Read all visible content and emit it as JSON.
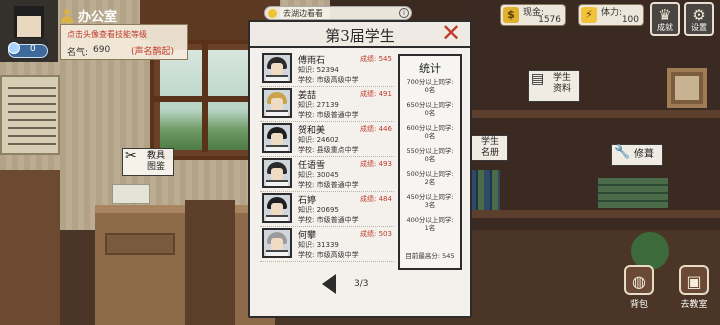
{
  "hud": {
    "level": "0",
    "location": "办公室",
    "hint": "点击头像查看技能等级",
    "fame_label": "名气:",
    "fame_value": "690",
    "fame_title": "(声名鹊起)"
  },
  "banner": {
    "text": "去湖边看看",
    "info_glyph": "i"
  },
  "resources": {
    "money_label": "现金:",
    "money_value": "1576",
    "money_icon": "$",
    "stamina_label": "体力:",
    "stamina_value": "100",
    "stamina_icon": "⚡"
  },
  "corner_buttons": {
    "achievement_label": "成就",
    "achievement_icon": "♛",
    "settings_label": "设置",
    "settings_icon": "⚙"
  },
  "scene_tags": {
    "teacher_plan": "教具图鉴",
    "student_info": "学生资料",
    "student_roster": "学生名册",
    "repair": "修葺"
  },
  "bottom_buttons": {
    "bag_label": "背包",
    "bag_icon": "◍",
    "class_label": "去教室",
    "class_icon": "▣"
  },
  "modal": {
    "title": "第3届学生",
    "close_glyph": "✕",
    "knowledge_prefix": "知识:",
    "school_prefix": "学校:",
    "score_prefix": "成绩:",
    "students": [
      {
        "name": "傅雨石",
        "score": "545",
        "knowledge": "52394",
        "school": "市级高级中学",
        "hair": "#2a2a2a"
      },
      {
        "name": "姜喆",
        "score": "491",
        "knowledge": "27139",
        "school": "市级普通中学",
        "hair": "#c9a24a"
      },
      {
        "name": "贺和美",
        "score": "446",
        "knowledge": "24602",
        "school": "县级重点中学",
        "hair": "#1f1f1f"
      },
      {
        "name": "任语雪",
        "score": "493",
        "knowledge": "30045",
        "school": "市级普通中学",
        "hair": "#2a2a2a"
      },
      {
        "name": "石婷",
        "score": "484",
        "knowledge": "20695",
        "school": "市级普通中学",
        "hair": "#1f1f1f"
      },
      {
        "name": "何攀",
        "score": "503",
        "knowledge": "31339",
        "school": "市级高级中学",
        "hair": "#9b9b9b"
      }
    ],
    "stats": {
      "title": "统计",
      "rows": [
        {
          "label": "700分以上同学:",
          "count": "0名"
        },
        {
          "label": "650分以上同学:",
          "count": "0名"
        },
        {
          "label": "600分以上同学:",
          "count": "0名"
        },
        {
          "label": "550分以上同学:",
          "count": "0名"
        },
        {
          "label": "500分以上同学:",
          "count": "2名"
        },
        {
          "label": "450分以上同学:",
          "count": "3名"
        },
        {
          "label": "400分以上同学:",
          "count": "1名"
        }
      ],
      "top_label": "目前最高分:",
      "top_value": "545"
    },
    "pager": "3/3"
  }
}
